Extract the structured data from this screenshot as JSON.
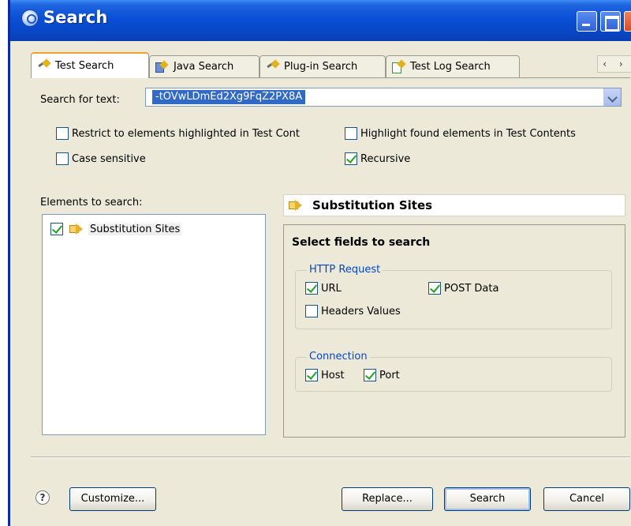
{
  "window": {
    "title": "Search"
  },
  "tabs": [
    {
      "label": "Test Search",
      "icon": "test-search-icon",
      "active": true
    },
    {
      "label": "Java Search",
      "icon": "java-search-icon",
      "active": false
    },
    {
      "label": "Plug-in Search",
      "icon": "plugin-search-icon",
      "active": false
    },
    {
      "label": "Test Log Search",
      "icon": "test-log-search-icon",
      "active": false
    }
  ],
  "search": {
    "label": "Search for text:",
    "value": "-tOVwLDmEd2Xg9FqZ2PX8A"
  },
  "options": {
    "restrict": {
      "label": "Restrict to elements highlighted in Test Cont",
      "checked": false
    },
    "highlight": {
      "label": "Highlight found elements in Test Contents",
      "checked": false
    },
    "case_sensitive": {
      "label": "Case sensitive",
      "checked": false
    },
    "recursive": {
      "label": "Recursive",
      "checked": true
    }
  },
  "elements": {
    "label": "Elements to search:",
    "items": [
      {
        "label": "Substitution Sites",
        "checked": true
      }
    ]
  },
  "details": {
    "title": "Substitution Sites",
    "fields_heading": "Select fields to search",
    "http_request": {
      "legend": "HTTP Request",
      "url": {
        "label": "URL",
        "checked": true
      },
      "post_data": {
        "label": "POST Data",
        "checked": true
      },
      "headers_values": {
        "label": "Headers Values",
        "checked": false
      }
    },
    "connection": {
      "legend": "Connection",
      "host": {
        "label": "Host",
        "checked": true
      },
      "port": {
        "label": "Port",
        "checked": true
      }
    }
  },
  "buttons": {
    "help": "?",
    "customize": "Customize...",
    "replace": "Replace...",
    "search": "Search",
    "cancel": "Cancel"
  },
  "tab_scroll": "‹ ›"
}
